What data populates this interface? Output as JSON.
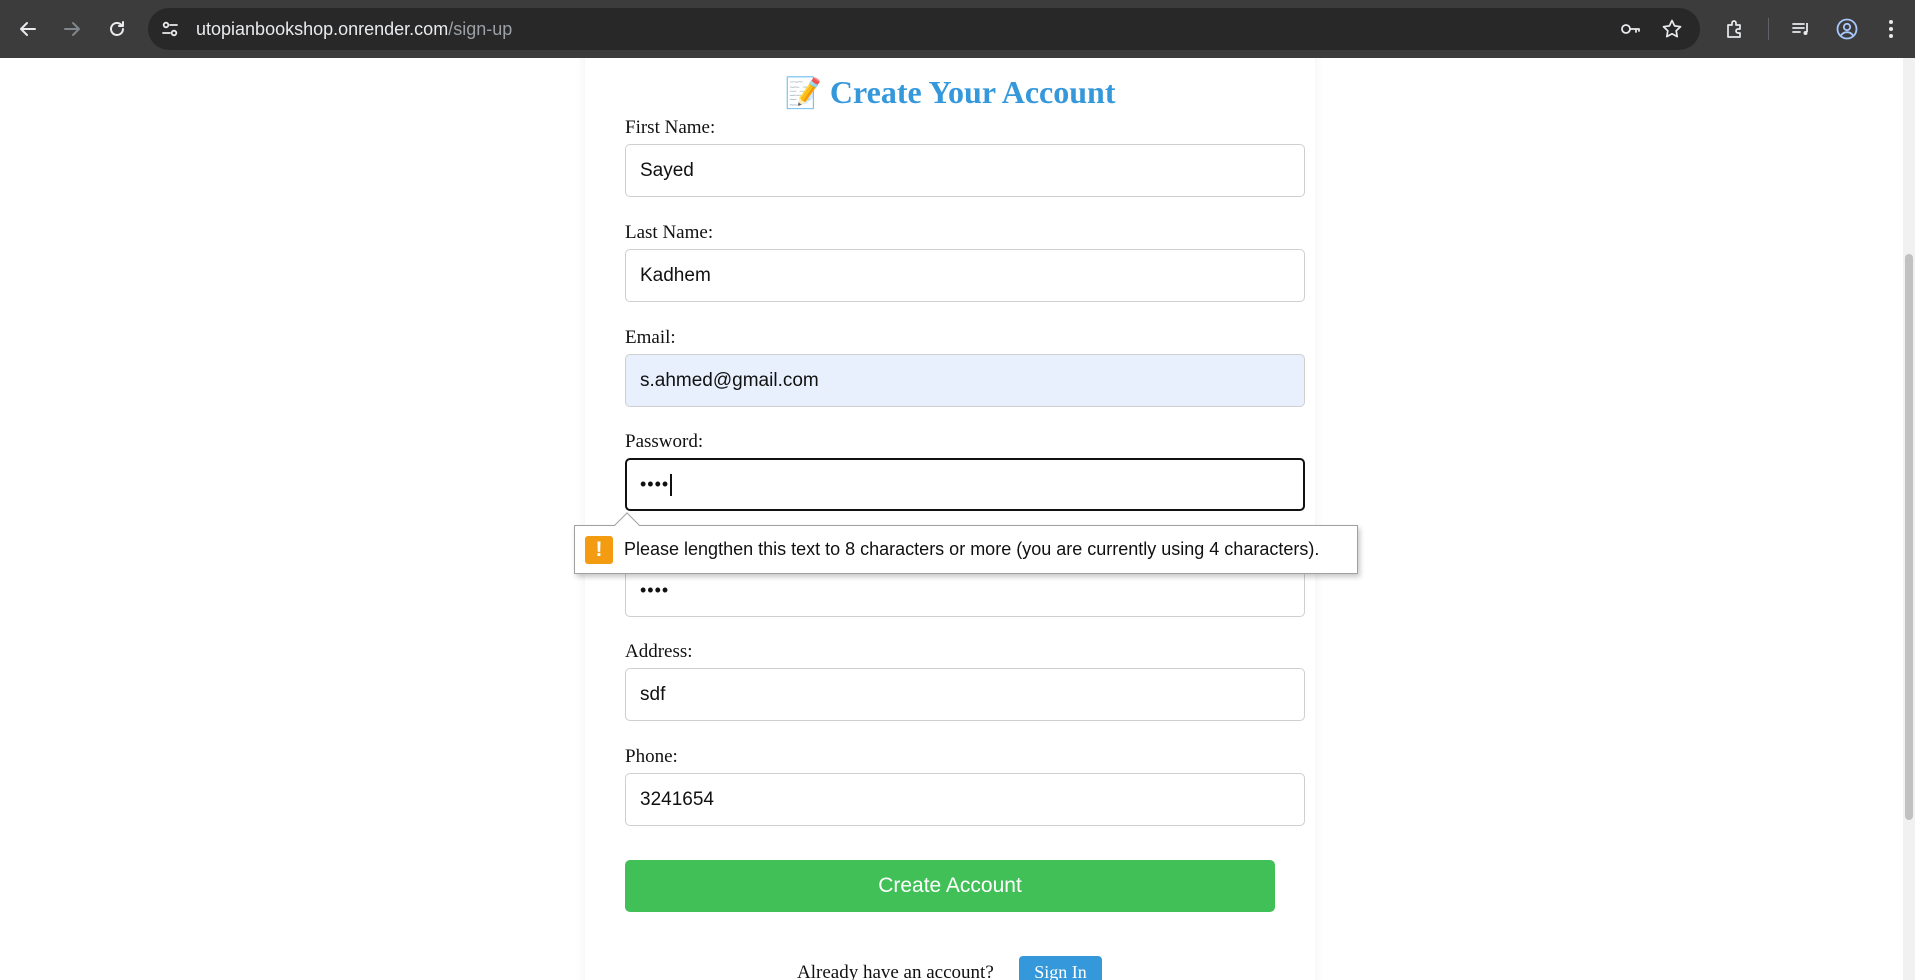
{
  "browser": {
    "url_host": "utopianbookshop.onrender.com",
    "url_path": "/sign-up"
  },
  "page": {
    "title_emoji": "📝",
    "title": "Create Your Account",
    "fields": {
      "first_name": {
        "label": "First Name:",
        "value": "Sayed"
      },
      "last_name": {
        "label": "Last Name:",
        "value": "Kadhem"
      },
      "email": {
        "label": "Email:",
        "value": "s.ahmed@gmail.com"
      },
      "password": {
        "label": "Password:",
        "value": "••••"
      },
      "confirm_password": {
        "value": "••••"
      },
      "address": {
        "label": "Address:",
        "value": "sdf"
      },
      "phone": {
        "label": "Phone:",
        "value": "3241654"
      }
    },
    "submit_label": "Create Account",
    "already_text": "Already have an account?",
    "signin_label": "Sign In"
  },
  "validation": {
    "icon": "!",
    "message": "Please lengthen this text to 8 characters or more (you are currently using 4 characters)."
  },
  "colors": {
    "title": "#3498db",
    "submit": "#40c057",
    "signin": "#3498db",
    "warning": "#f39c12"
  }
}
